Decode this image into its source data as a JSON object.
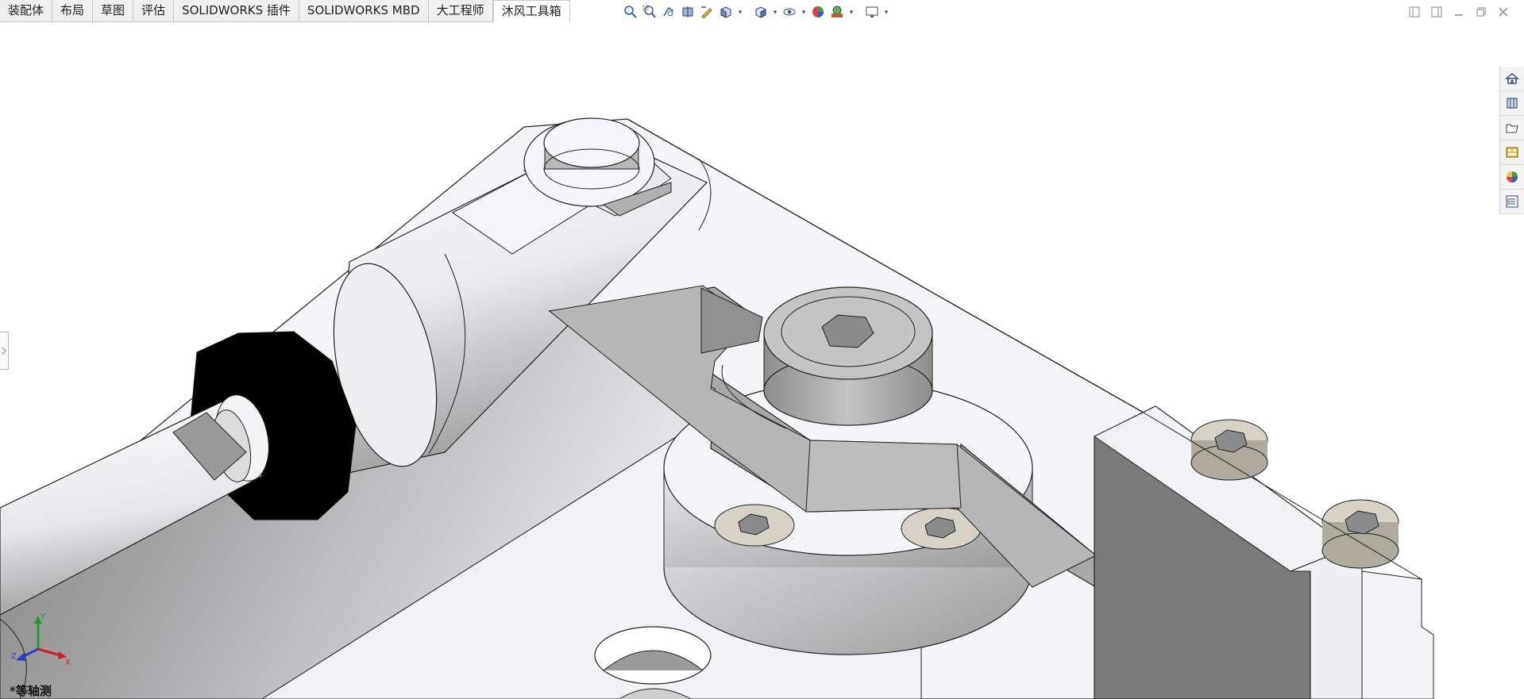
{
  "tabs": [
    {
      "label": "装配体",
      "active": false
    },
    {
      "label": "布局",
      "active": false
    },
    {
      "label": "草图",
      "active": false
    },
    {
      "label": "评估",
      "active": false
    },
    {
      "label": "SOLIDWORKS 插件",
      "active": false
    },
    {
      "label": "SOLIDWORKS MBD",
      "active": false
    },
    {
      "label": "大工程师",
      "active": false
    },
    {
      "label": "沐风工具箱",
      "active": true
    }
  ],
  "heads_up_toolbar": {
    "icons": [
      "zoom-to-fit-icon",
      "zoom-to-area-icon",
      "previous-view-icon",
      "section-view-icon",
      "dynamic-annotation-icon",
      "view-orientation-icon",
      "display-style-icon",
      "hide-show-items-icon",
      "edit-appearance-icon",
      "apply-scene-icon",
      "view-settings-icon"
    ]
  },
  "viewport": {
    "view_label": "*等轴测",
    "triad": {
      "x": "X",
      "y": "Y",
      "z": "Z"
    }
  },
  "task_pane": {
    "icons": [
      "home-icon",
      "design-library-icon",
      "file-explorer-icon",
      "view-palette-icon",
      "appearances-icon",
      "custom-properties-icon"
    ]
  },
  "colors": {
    "background": "#ffffff",
    "part_light": "#f4f4f8",
    "part_mid": "#b4b4b4",
    "part_dark": "#8a8a8a",
    "nut": "#000000",
    "screw_head": "#d8d2c6",
    "triad_x": "#d02020",
    "triad_y": "#1f9a2a",
    "triad_z": "#2a3fbf"
  }
}
